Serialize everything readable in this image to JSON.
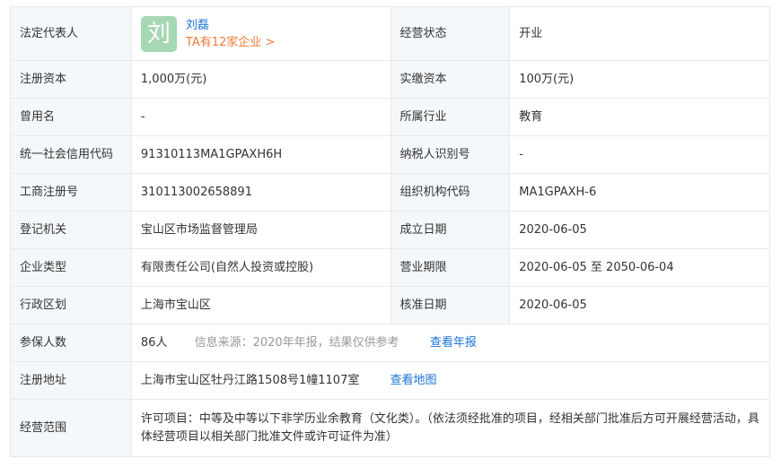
{
  "legal_rep": {
    "label": "法定代表人",
    "avatar_char": "刘",
    "name": "刘磊",
    "companies_link": "TA有12家企业 >",
    "status_label": "经营状态",
    "status_value": "开业"
  },
  "rows": {
    "capital": {
      "label": "注册资本",
      "value": "1,000万(元)",
      "label2": "实缴资本",
      "value2": "100万(元)"
    },
    "former_name": {
      "label": "曾用名",
      "value": "-",
      "label2": "所属行业",
      "value2": "教育"
    },
    "credit_code": {
      "label": "统一社会信用代码",
      "value": "91310113MA1GPAXH6H",
      "label2": "纳税人识别号",
      "value2": "-"
    },
    "reg_no": {
      "label": "工商注册号",
      "value": "310113002658891",
      "label2": "组织机构代码",
      "value2": "MA1GPAXH-6"
    },
    "authority": {
      "label": "登记机关",
      "value": "宝山区市场监督管理局",
      "label2": "成立日期",
      "value2": "2020-06-05"
    },
    "type": {
      "label": "企业类型",
      "value": "有限责任公司(自然人投资或控股)",
      "label2": "营业期限",
      "value2": "2020-06-05 至 2050-06-04"
    },
    "region": {
      "label": "行政区划",
      "value": "上海市宝山区",
      "label2": "核准日期",
      "value2": "2020-06-05"
    }
  },
  "insured": {
    "label": "参保人数",
    "value": "86人",
    "note": "信息来源：2020年年报，结果仅供参考",
    "link": "查看年报"
  },
  "address": {
    "label": "注册地址",
    "value": "上海市宝山区牡丹江路1508号1幢1107室",
    "link": "查看地图"
  },
  "scope": {
    "label": "经营范围",
    "value": "许可项目：中等及中等以下非学历业余教育（文化类）。（依法须经批准的项目，经相关部门批准后方可开展经营活动，具体经营项目以相关部门批准文件或许可证件为准）"
  },
  "colors": {
    "label_bg": "#f5f8fb",
    "border": "#e8e8e8",
    "link": "#1a73d9",
    "orange": "#f07a38",
    "avatar": "#a6d8b3"
  }
}
